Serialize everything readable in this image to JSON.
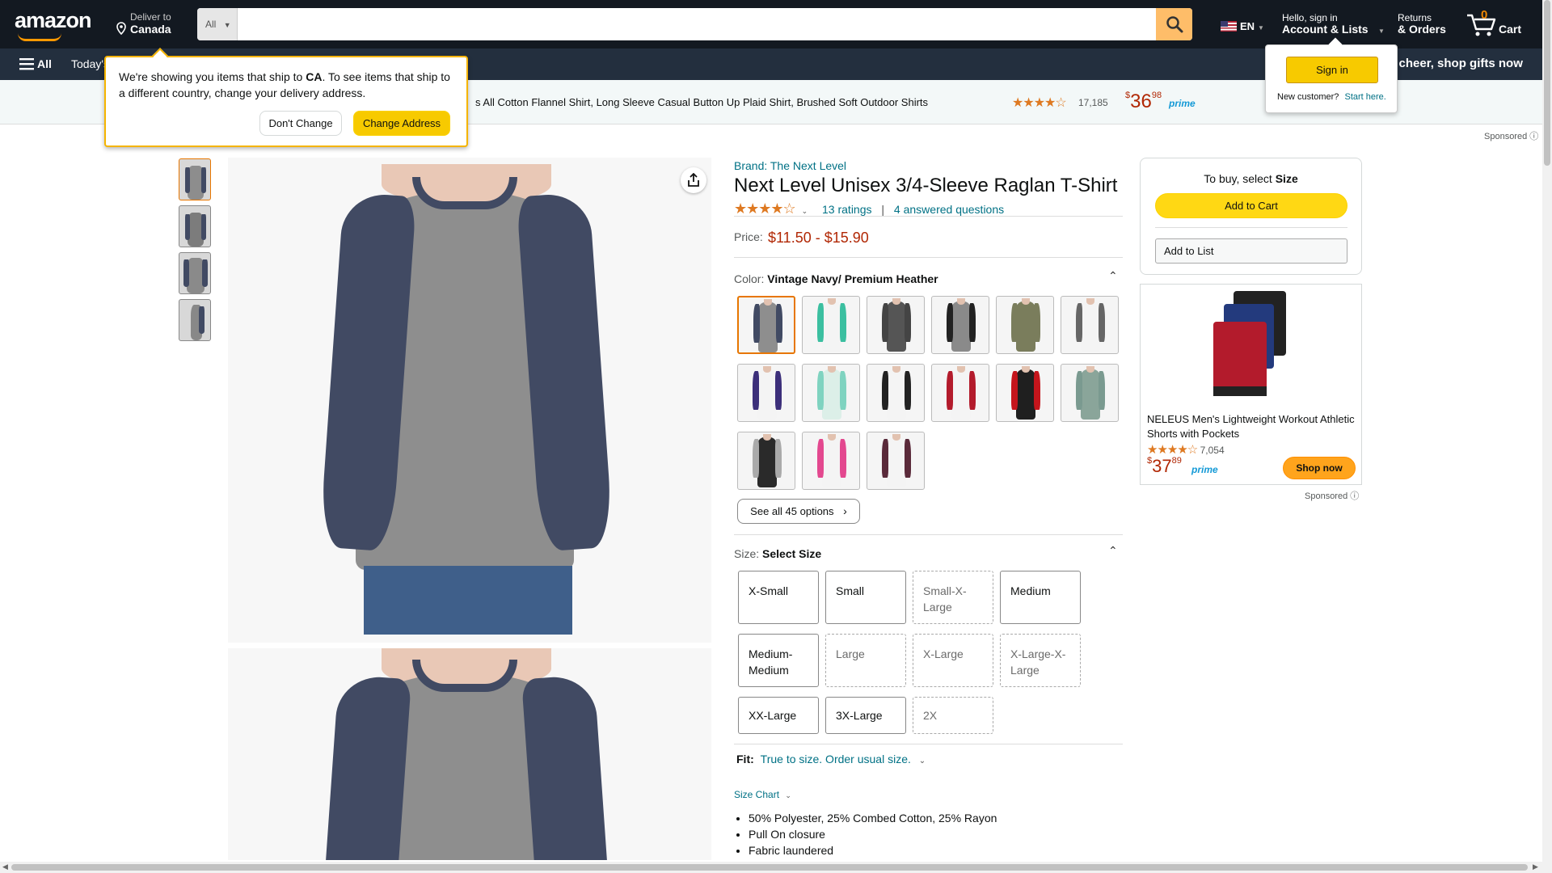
{
  "nav": {
    "logo": "amazon",
    "deliver_line1": "Deliver to",
    "deliver_line2": "Canada",
    "search_category": "All",
    "search_placeholder": "",
    "language": "EN",
    "account_line1": "Hello, sign in",
    "account_line2": "Account & Lists",
    "returns_line1": "Returns",
    "returns_line2": "& Orders",
    "cart_count": "0",
    "cart_label": "Cart"
  },
  "subnav": {
    "all_label": "All",
    "todays_deals": "Today's",
    "promo": "e cheer, shop gifts now"
  },
  "ad_strip": {
    "title": "s All Cotton Flannel Shirt, Long Sleeve Casual Button Up Plaid Shirt, Brushed Soft Outdoor Shirts",
    "rating_count": "17,185",
    "price_symbol": "$",
    "price_whole": "36",
    "price_frac": "98",
    "prime": "prime",
    "sponsored": "Sponsored"
  },
  "location_popup": {
    "text_before": "We're showing you items that ship to ",
    "country": "CA",
    "text_after": ". To see items that ship to a different country, change your delivery address.",
    "dont_change": "Don't Change",
    "change_address": "Change Address"
  },
  "signin_popup": {
    "button": "Sign in",
    "new_customer": "New customer?",
    "start_here": "Start here."
  },
  "product": {
    "brand": "Brand: The Next Level",
    "title": "Next Level Unisex 3/4-Sleeve Raglan T-Shirt",
    "ratings": "13 ratings",
    "separator": "|",
    "questions": "4 answered questions",
    "price_label": "Price:",
    "price": "$11.50 - $15.90",
    "color_label": "Color:",
    "color_value": "Vintage Navy/ Premium Heather",
    "see_all": "See all 45 options",
    "size_label": "Size:",
    "size_value": "Select Size",
    "sizes": [
      "X-Small",
      "Small",
      "Small-X-Large",
      "Medium",
      "Medium-Medium",
      "Large",
      "X-Large",
      "X-Large-X-Large",
      "XX-Large",
      "3X-Large",
      "2X"
    ],
    "fit_label": "Fit:",
    "fit_value": "True to size. Order usual size.",
    "size_chart": "Size Chart",
    "bullets": [
      "50% Polyester, 25% Combed Cotton, 25% Rayon",
      "Pull On closure",
      "Fabric laundered"
    ]
  },
  "buybox": {
    "to_buy_prefix": "To buy, select",
    "to_buy_strong": "Size",
    "add_to_cart": "Add to Cart",
    "add_to_list": "Add to List"
  },
  "side_ad": {
    "title": "NELEUS Men's Lightweight Workout Athletic Shorts with Pockets",
    "rating_count": "7,054",
    "price_symbol": "$",
    "price_whole": "37",
    "price_frac": "89",
    "prime": "prime",
    "shop_now": "Shop now",
    "sponsored": "Sponsored"
  },
  "colors": {
    "nav_bg": "#131921",
    "subnav_bg": "#232f3e",
    "accent": "#ff9900",
    "button_yellow": "#ffd814",
    "price_red": "#b12704",
    "link": "#007185"
  }
}
